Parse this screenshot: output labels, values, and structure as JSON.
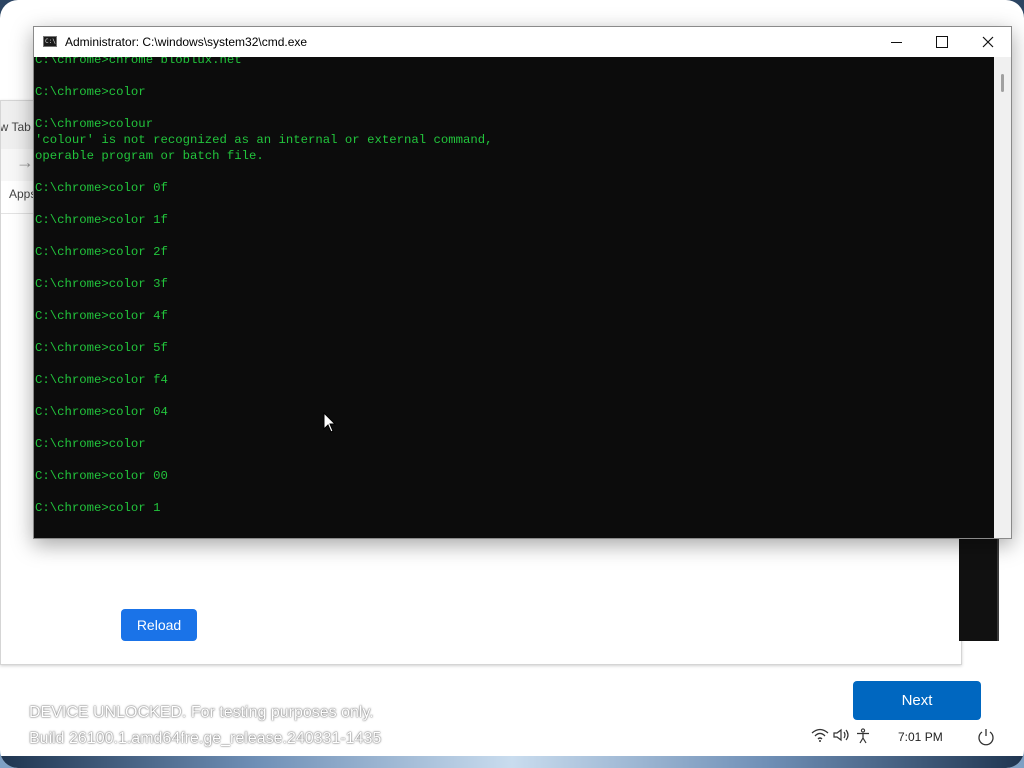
{
  "background_window": {
    "tab_label": "ew Tab",
    "apps_label": "Apps",
    "reload_button": "Reload"
  },
  "cmd_window": {
    "title": "Administrator: C:\\windows\\system32\\cmd.exe",
    "icon_text": "C:\\",
    "text_color": "#22c43c",
    "lines": [
      "C:\\chrome>chrome bloblux.net",
      "",
      "C:\\chrome>color",
      "",
      "C:\\chrome>colour",
      "'colour' is not recognized as an internal or external command,",
      "operable program or batch file.",
      "",
      "C:\\chrome>color 0f",
      "",
      "C:\\chrome>color 1f",
      "",
      "C:\\chrome>color 2f",
      "",
      "C:\\chrome>color 3f",
      "",
      "C:\\chrome>color 4f",
      "",
      "C:\\chrome>color 5f",
      "",
      "C:\\chrome>color f4",
      "",
      "C:\\chrome>color 04",
      "",
      "C:\\chrome>color",
      "",
      "C:\\chrome>color 00",
      "",
      "C:\\chrome>color 1"
    ]
  },
  "oobe": {
    "next_button": "Next",
    "watermark_line1": "DEVICE UNLOCKED. For testing purposes only.",
    "watermark_line2": "Build 26100.1.amd64fre.ge_release.240331-1435",
    "time": "7:01 PM",
    "icons": [
      "wifi-icon",
      "volume-icon",
      "accessibility-icon",
      "power-icon"
    ],
    "accent_color": "#0067c0"
  }
}
